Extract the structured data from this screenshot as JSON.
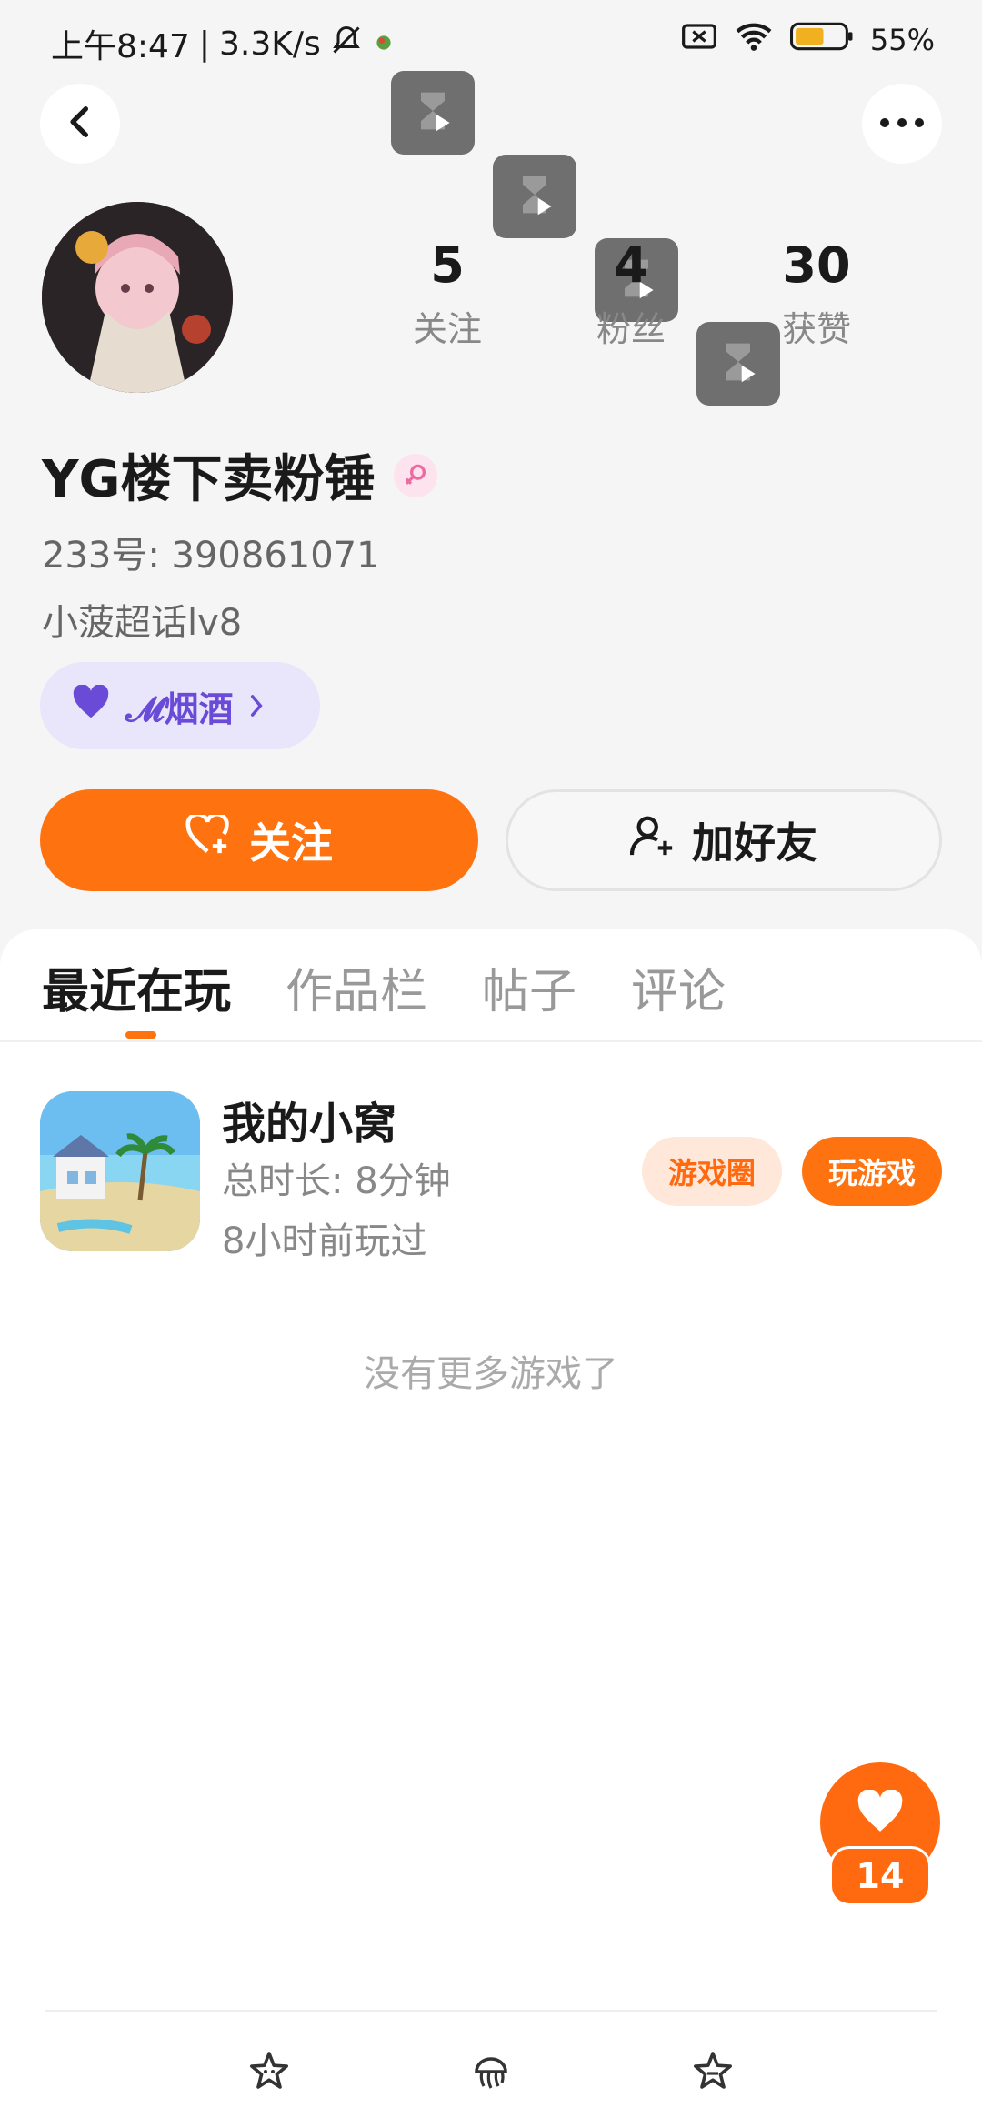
{
  "status_bar": {
    "time": "上午8:47",
    "net_speed": "3.3K/s",
    "battery": "55%"
  },
  "profile": {
    "name": "YG楼下卖粉锤",
    "uid": "233号: 390861071",
    "bio": "小菠超话lv8",
    "tag": "𝓜烟酒",
    "stats": [
      {
        "value": "5",
        "label": "关注"
      },
      {
        "value": "4",
        "label": "粉丝"
      },
      {
        "value": "30",
        "label": "获赞"
      }
    ]
  },
  "actions": {
    "follow": "关注",
    "add_friend": "加好友"
  },
  "tabs": [
    {
      "label": "最近在玩",
      "active": true
    },
    {
      "label": "作品栏",
      "active": false
    },
    {
      "label": "帖子",
      "active": false
    },
    {
      "label": "评论",
      "active": false
    }
  ],
  "recent_game": {
    "title": "我的小窝",
    "duration": "总时长: 8分钟",
    "last_played": "8小时前玩过",
    "circle_label": "游戏圈",
    "play_label": "玩游戏"
  },
  "empty_message": "没有更多游戏了",
  "like_fab": {
    "count": "14"
  },
  "colors": {
    "accent": "#ff7210",
    "tag_bg": "#e9e5fb",
    "tag_text": "#6a4bd8"
  },
  "icons": [
    "back-icon",
    "more-icon",
    "hourglass-icon",
    "female-icon",
    "heart-icon",
    "heart-plus-icon",
    "add-user-icon",
    "star-icon",
    "jellyfish-icon"
  ]
}
